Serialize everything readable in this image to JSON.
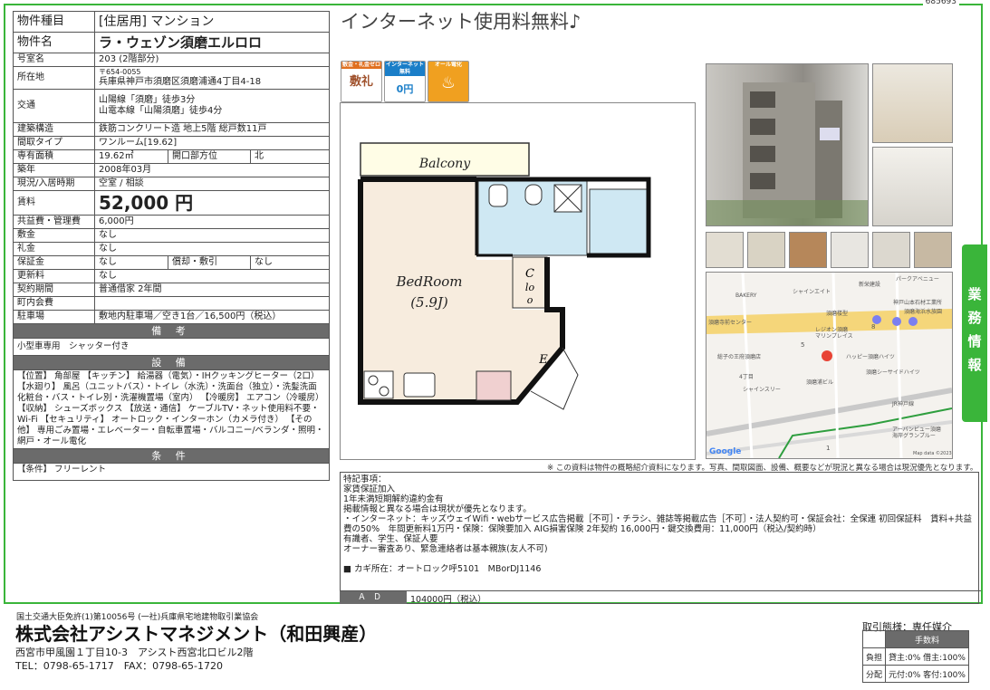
{
  "doc_id": "685693",
  "headline": "インターネット使用料無料♪",
  "spec": {
    "type_label": "物件種目",
    "type_value": "[住居用] マンション",
    "name_label": "物件名",
    "name_value": "ラ・ウェゾン須磨エルロロ",
    "room_label": "号室名",
    "room_value": "203 (2階部分)",
    "loc_label": "所在地",
    "zip": "〒654-0055",
    "address": "兵庫県神戸市須磨区須磨浦通4丁目4-18",
    "access_label": "交通",
    "access1": "山陽線「須磨」徒歩3分",
    "access2": "山電本線「山陽須磨」徒歩4分",
    "struct_label": "建築構造",
    "struct_value": "鉄筋コンクリート造 地上5階 総戸数11戸",
    "layout_label": "間取タイプ",
    "layout_value": "ワンルーム[19.62]",
    "area_label": "専有面積",
    "area_value": "19.62㎡",
    "dir_label": "開口部方位",
    "dir_value": "北",
    "built_label": "築年",
    "built_value": "2008年03月",
    "status_label": "現況/入居時期",
    "status_value": "空室 / 相談",
    "rent_label": "賃料",
    "rent_value": "52,000 円",
    "common_label": "共益費・管理費",
    "common_value": "6,000円",
    "deposit_label": "敷金",
    "deposit_value": "なし",
    "key_label": "礼金",
    "key_value": "なし",
    "guarantee_label": "保証金",
    "guarantee_value": "なし",
    "amort_label": "償却・敷引",
    "amort_value": "なし",
    "renew_label": "更新料",
    "renew_value": "なし",
    "contract_label": "契約期間",
    "contract_value": "普通借家 2年間",
    "town_label": "町内会費",
    "town_value": "",
    "parking_label": "駐車場",
    "parking_value": "敷地内駐車場／空き1台／16,500円（税込）"
  },
  "notes_head": "備 考",
  "notes": "小型車専用　シャッター付き",
  "equip_head": "設 備",
  "equip": "【位置】 角部屋 【キッチン】 給湯器（電気）・IHクッキングヒーター（2口） 【水廻り】 風呂（ユニットバス）・トイレ（水洗）・洗面台（独立）・洗髪洗面化粧台・バス・トイレ別・洗濯機置場（室内） 【冷暖房】 エアコン（冷暖房） 【収納】 シューズボックス 【放送・通信】 ケーブルTV・ネット使用料不要・Wi-Fi 【セキュリティ】 オートロック・インターホン（カメラ付き） 【その他】 専用ごみ置場・エレベーター・自転車置場・バルコニー/ベランダ・照明・網戸・オール電化",
  "cond_head": "条 件",
  "cond": "【条件】 フリーレント",
  "badges": [
    {
      "label": "敷金・礼金ゼロ",
      "glyph": "敷礼",
      "color": "#e07020"
    },
    {
      "label": "インターネット無料",
      "glyph": "0円",
      "color": "#1a7ec8"
    },
    {
      "label": "オール電化",
      "glyph": "♨",
      "color": "#f0a020"
    }
  ],
  "plan": {
    "balcony": "Balcony",
    "bedroom": "BedRoom",
    "bedroom_size": "(5.9J)",
    "closet1": "C",
    "closet2": "lo",
    "closet3": "o",
    "entrance": "E"
  },
  "map": {
    "labels": [
      "パークアベニュー",
      "シャインエイト",
      "新栄建設",
      "BAKERY",
      "神戸山本石材工業所",
      "須磨海浜水族園",
      "須磨寺前センター",
      "須磨楼型",
      "レジオン須磨",
      "マリンプレイス",
      "ハッピー須磨ハイツ",
      "須磨シーサイドハイツ",
      "総子の王府須磨店",
      "4丁目",
      "須磨浦ビル",
      "シャインスリー",
      "JR神戸線",
      "アーバンビュー須磨",
      "海岸グランプルー",
      "Google",
      "Map data ©2023"
    ],
    "numbers": [
      "5",
      "8",
      "1"
    ]
  },
  "sidetab": [
    "業",
    "務",
    "情",
    "報"
  ],
  "disclaimer": "※ この資料は物件の概略紹介資料になります。写真、間取図面、設備、概要などが現況と異なる場合は現況優先となります。",
  "remarks": {
    "text": "特記事項：\n家賃保証加入\n1年未満短期解約違約金有\n掲載情報と異なる場合は現状が優先となります。\n・インターネット：キッズウェイWifi・webサービス広告掲載［不可］・チラシ、雑誌等掲載広告［不可］・法人契約可・保証会社：全保連 初回保証料　賃料+共益\n費の50%　年間更新料1万円・保険：保険要加入 AIG損害保険 2年契約 16,000円・鍵交換費用：11,000円（税込/契約時）\n有識者、学生、保証人要\nオーナー審査あり、緊急連絡者は基本親族(友人不可)\n\n■ カギ所在：オートロック呼5101　MBorDJ1146",
    "ad_label": "ＡＤ",
    "ad_value": "104000円（税込）"
  },
  "footer": {
    "license": "国土交通大臣免許(1)第10056号 (一社)兵庫県宅地建物取引業協会",
    "company": "株式会社アシストマネジメント（和田興産）",
    "address": "西宮市甲風園１丁目10-3　アシスト西宮北口ビル2階",
    "tel": "TEL：0798-65-1717　FAX：0798-65-1720",
    "deal": "取引態様：専任媒介",
    "fee_head": "手数料",
    "burden_label": "負担",
    "burden_value": "貸主:0% 借主:100%",
    "dist_label": "分配",
    "dist_value": "元付:0% 客付:100%"
  }
}
